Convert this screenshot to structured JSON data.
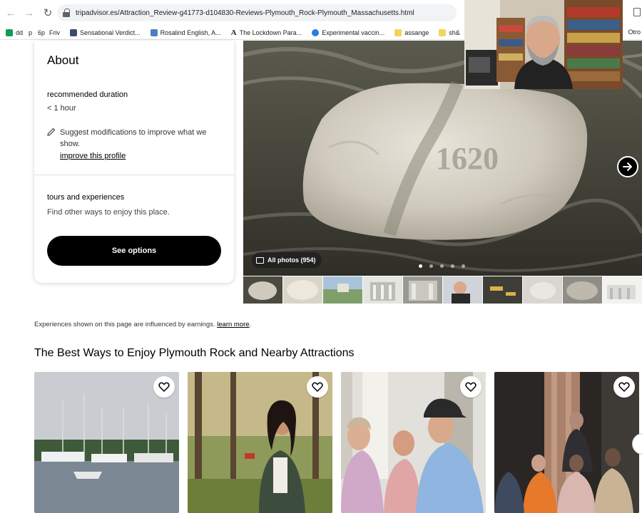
{
  "browser": {
    "url": "tripadvisor.es/Attraction_Review-g41773-d104830-Reviews-Plymouth_Rock-Plymouth_Massachusetts.html",
    "bookmarks": [
      "dd",
      "p",
      "6p",
      "Friv",
      "Sensational Verdict...",
      "Rosalind English, A...",
      "The Lockdown Para...",
      "Experimental vaccin...",
      "assange",
      "sh&"
    ],
    "bookmarks_right": "Otro"
  },
  "about": {
    "title": "About",
    "duration_label": "recommended duration",
    "duration_value": "< 1 hour",
    "suggest_text": "Suggest modifications to improve what we show.",
    "improve_link": "improve this profile",
    "tours_label": "tours and experiences",
    "tours_sub": "Find other ways to enjoy this place.",
    "see_options": "See options"
  },
  "gallery": {
    "all_photos": "All photos (954)",
    "dot_count": 5,
    "active_dot": 0,
    "rock_engraving": "1620"
  },
  "disclaimer": {
    "text": "Experiences shown on this page are influenced by earnings.",
    "link": "learn more",
    "suffix": "."
  },
  "section_title": "The Best Ways to Enjoy Plymouth Rock and Nearby Attractions",
  "colors": {
    "button_bg": "#000000",
    "text": "#000000"
  }
}
